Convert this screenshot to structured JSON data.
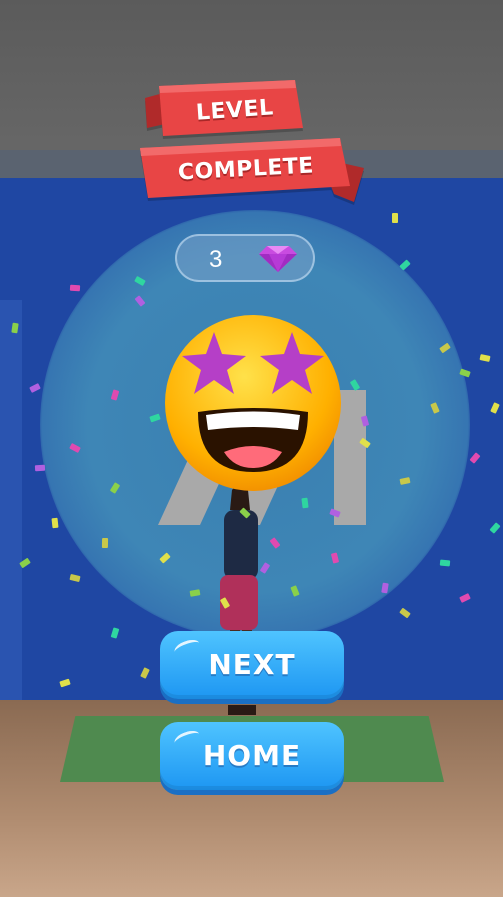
{
  "banner": {
    "line1": "LEVEL",
    "line2": "COMPLETE"
  },
  "reward": {
    "count": "3",
    "icon": "gem-icon"
  },
  "emoji": {
    "icon": "star-struck-emoji"
  },
  "buttons": {
    "next_label": "NEXT",
    "home_label": "HOME"
  },
  "colors": {
    "banner_red": "#e84545",
    "button_blue": "#2aa6f7",
    "wall_blue": "#1f47a3",
    "gem_purple": "#c94be0"
  }
}
